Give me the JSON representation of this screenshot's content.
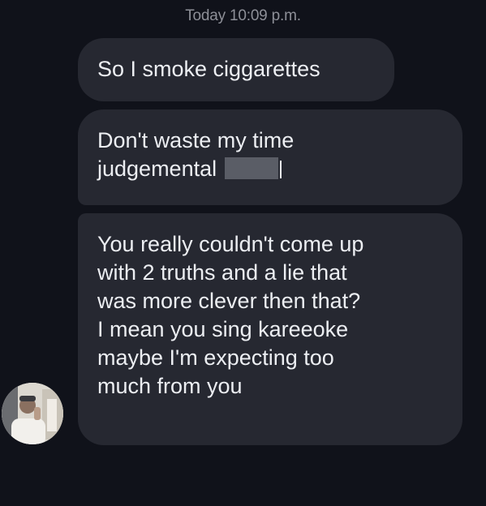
{
  "conversation": {
    "timestamp": {
      "day": "Today",
      "time": "10:09 p.m."
    },
    "messages": [
      {
        "text": "So I smoke ciggarettes"
      },
      {
        "line1": "Don't waste my time",
        "line2": "judgemental"
      },
      {
        "lines": [
          "You really couldn't come up",
          "with 2 truths and a lie that",
          "was more clever then that?",
          "I mean you sing kareeoke",
          "maybe I'm expecting too",
          "much from you"
        ]
      }
    ],
    "sender_avatar_icon": "person-photo-avatar"
  }
}
